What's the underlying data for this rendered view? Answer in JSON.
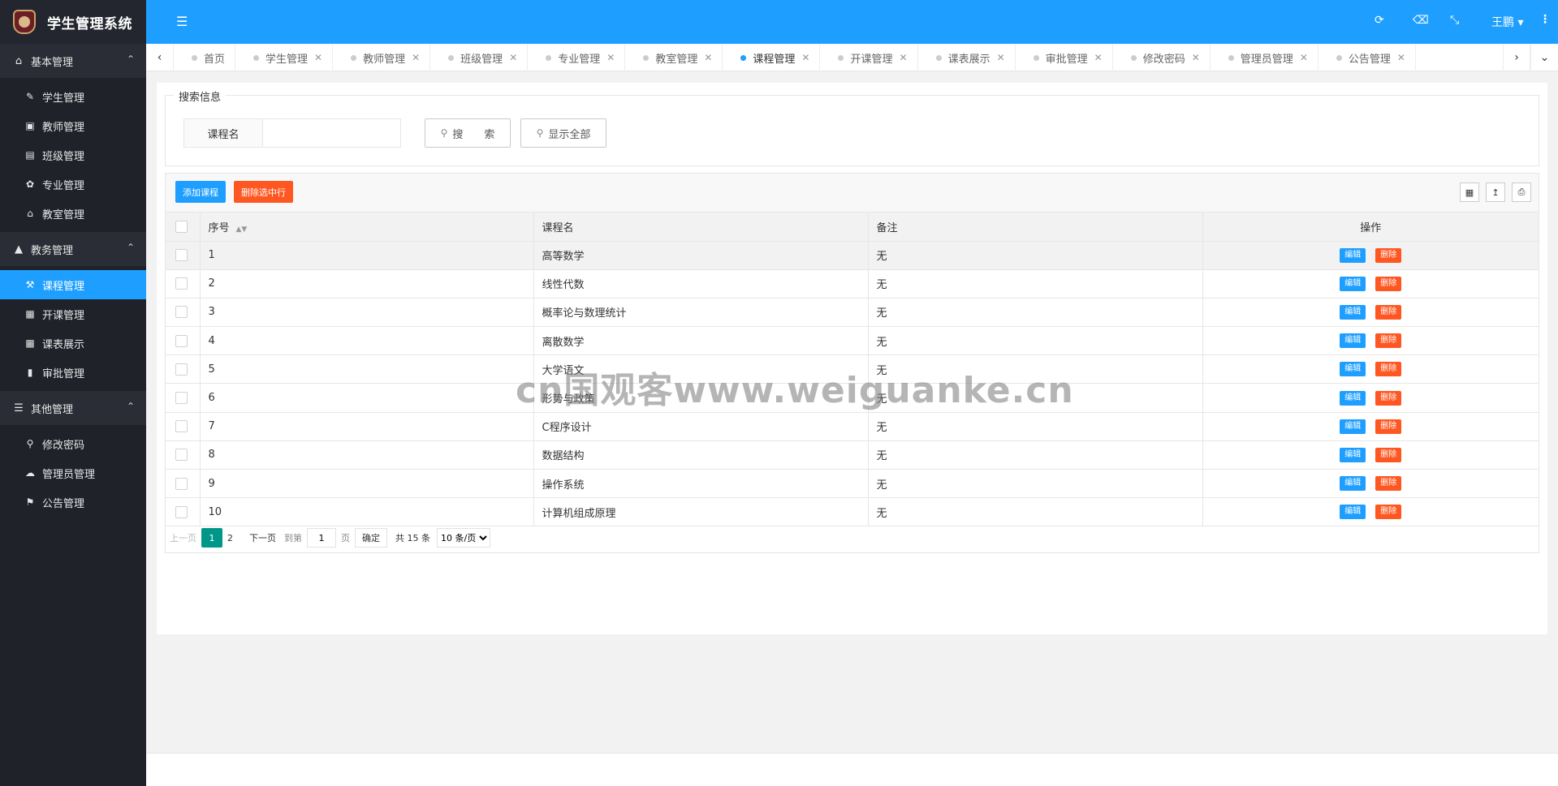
{
  "app": {
    "title": "学生管理系统"
  },
  "sidebar": {
    "groups": [
      {
        "label": "基本管理",
        "icon": "home-icon",
        "items": [
          {
            "label": "学生管理",
            "icon": "pencil-icon"
          },
          {
            "label": "教师管理",
            "icon": "briefcase-icon"
          },
          {
            "label": "班级管理",
            "icon": "window-icon"
          },
          {
            "label": "专业管理",
            "icon": "leaf-icon"
          },
          {
            "label": "教室管理",
            "icon": "bank-icon"
          }
        ]
      },
      {
        "label": "教务管理",
        "icon": "graduation-cap-icon",
        "items": [
          {
            "label": "课程管理",
            "icon": "gavel-icon",
            "active": true
          },
          {
            "label": "开课管理",
            "icon": "calendar-icon"
          },
          {
            "label": "课表展示",
            "icon": "table-icon"
          },
          {
            "label": "审批管理",
            "icon": "book-icon"
          }
        ]
      },
      {
        "label": "其他管理",
        "icon": "list-icon",
        "items": [
          {
            "label": "修改密码",
            "icon": "key-icon"
          },
          {
            "label": "管理员管理",
            "icon": "cloud-icon"
          },
          {
            "label": "公告管理",
            "icon": "bullhorn-icon"
          }
        ]
      }
    ]
  },
  "header": {
    "user": "王鹏",
    "icons": [
      "refresh-icon",
      "trash-icon",
      "fullscreen-icon",
      "more-icon"
    ],
    "accent": "#1e9fff"
  },
  "tabs": [
    {
      "label": "首页",
      "closable": false
    },
    {
      "label": "学生管理",
      "closable": true
    },
    {
      "label": "教师管理",
      "closable": true
    },
    {
      "label": "班级管理",
      "closable": true
    },
    {
      "label": "专业管理",
      "closable": true
    },
    {
      "label": "教室管理",
      "closable": true
    },
    {
      "label": "课程管理",
      "closable": true,
      "active": true
    },
    {
      "label": "开课管理",
      "closable": true
    },
    {
      "label": "课表展示",
      "closable": true
    },
    {
      "label": "审批管理",
      "closable": true
    },
    {
      "label": "修改密码",
      "closable": true
    },
    {
      "label": "管理员管理",
      "closable": true
    },
    {
      "label": "公告管理",
      "closable": true
    }
  ],
  "search": {
    "legend": "搜索信息",
    "field_label": "课程名",
    "field_value": "",
    "search_button": "搜　　索",
    "show_all_button": "显示全部"
  },
  "toolbar": {
    "add_label": "添加课程",
    "delete_selected_label": "删除选中行",
    "add_color": "#1e9fff",
    "delete_color": "#ff5722"
  },
  "table": {
    "columns": [
      "序号",
      "课程名",
      "备注",
      "操作"
    ],
    "edit_label": "编辑",
    "delete_label": "删除",
    "rows": [
      {
        "id": "1",
        "name": "高等数学",
        "note": "无"
      },
      {
        "id": "2",
        "name": "线性代数",
        "note": "无"
      },
      {
        "id": "3",
        "name": "概率论与数理统计",
        "note": "无"
      },
      {
        "id": "4",
        "name": "离散数学",
        "note": "无"
      },
      {
        "id": "5",
        "name": "大学语文",
        "note": "无"
      },
      {
        "id": "6",
        "name": "形势与政策",
        "note": "无"
      },
      {
        "id": "7",
        "name": "C程序设计",
        "note": "无"
      },
      {
        "id": "8",
        "name": "数据结构",
        "note": "无"
      },
      {
        "id": "9",
        "name": "操作系统",
        "note": "无"
      },
      {
        "id": "10",
        "name": "计算机组成原理",
        "note": "无"
      }
    ]
  },
  "pager": {
    "prev": "上一页",
    "pages": [
      "1",
      "2"
    ],
    "current": "1",
    "next": "下一页",
    "goto_label": "到第",
    "goto_value": "1",
    "page_unit": "页",
    "confirm": "确定",
    "total": "共 15 条",
    "page_size": "10 条/页"
  },
  "watermark": "cn国观客www.weiguanke.cn"
}
